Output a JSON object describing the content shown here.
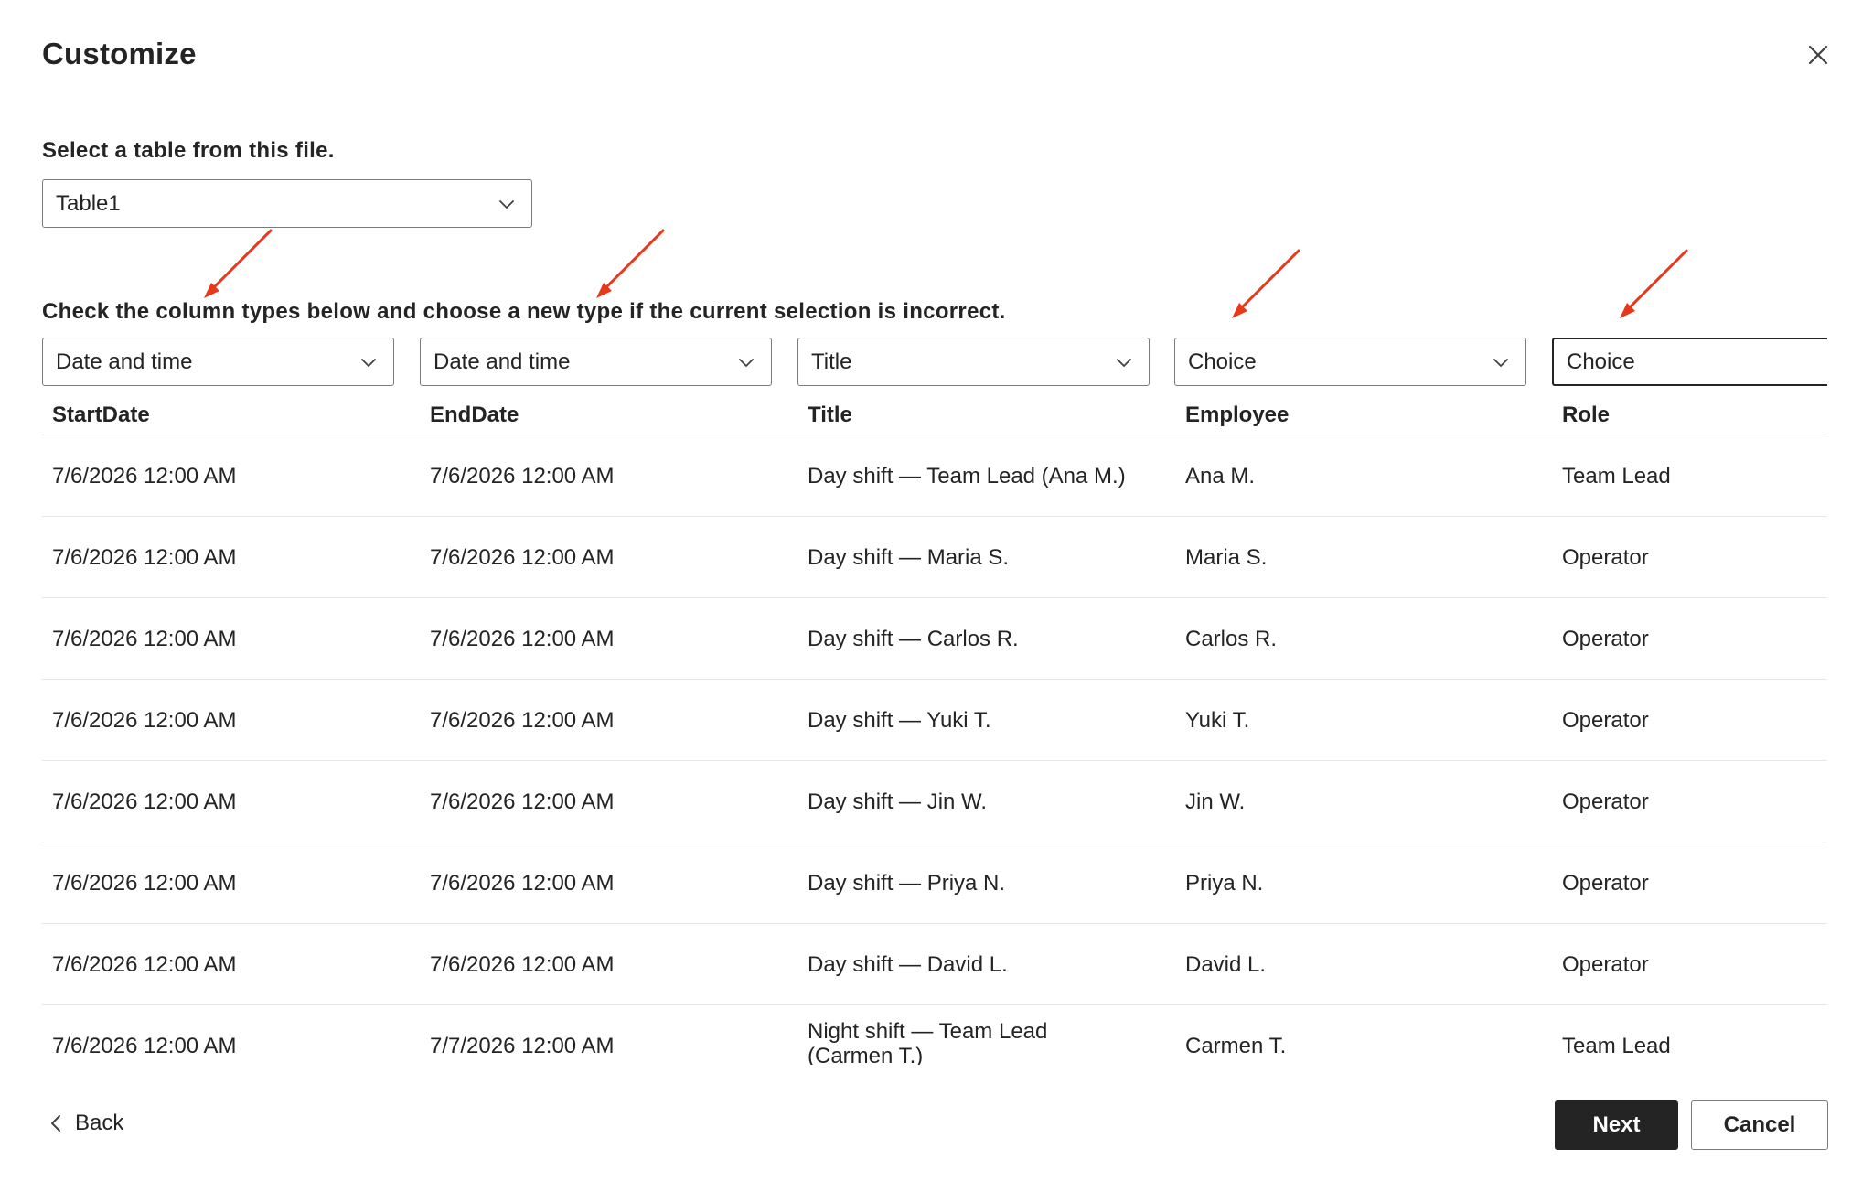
{
  "dialog": {
    "title": "Customize",
    "close_icon": "close-icon"
  },
  "table_picker": {
    "label": "Select a table from this file.",
    "selected": "Table1"
  },
  "column_types": {
    "instruction": "Check the column types below and choose a new type if the current selection is incorrect.",
    "columns": [
      {
        "type": "Date and time",
        "header": "StartDate"
      },
      {
        "type": "Date and time",
        "header": "EndDate"
      },
      {
        "type": "Title",
        "header": "Title"
      },
      {
        "type": "Choice",
        "header": "Employee"
      },
      {
        "type": "Choice",
        "header": "Role"
      }
    ]
  },
  "annotations": {
    "arrow_color": "#e8381a"
  },
  "rows": [
    [
      "7/6/2026 12:00 AM",
      "7/6/2026 12:00 AM",
      "Day shift — Team Lead (Ana M.)",
      "Ana M.",
      "Team Lead"
    ],
    [
      "7/6/2026 12:00 AM",
      "7/6/2026 12:00 AM",
      "Day shift — Maria S.",
      "Maria S.",
      "Operator"
    ],
    [
      "7/6/2026 12:00 AM",
      "7/6/2026 12:00 AM",
      "Day shift — Carlos R.",
      "Carlos R.",
      "Operator"
    ],
    [
      "7/6/2026 12:00 AM",
      "7/6/2026 12:00 AM",
      "Day shift — Yuki T.",
      "Yuki T.",
      "Operator"
    ],
    [
      "7/6/2026 12:00 AM",
      "7/6/2026 12:00 AM",
      "Day shift — Jin W.",
      "Jin W.",
      "Operator"
    ],
    [
      "7/6/2026 12:00 AM",
      "7/6/2026 12:00 AM",
      "Day shift — Priya N.",
      "Priya N.",
      "Operator"
    ],
    [
      "7/6/2026 12:00 AM",
      "7/6/2026 12:00 AM",
      "Day shift — David L.",
      "David L.",
      "Operator"
    ],
    [
      "7/6/2026 12:00 AM",
      "7/7/2026 12:00 AM",
      "Night shift — Team Lead (Carmen T.)",
      "Carmen T.",
      "Team Lead"
    ]
  ],
  "footer": {
    "back_label": "Back",
    "next_label": "Next",
    "cancel_label": "Cancel"
  }
}
